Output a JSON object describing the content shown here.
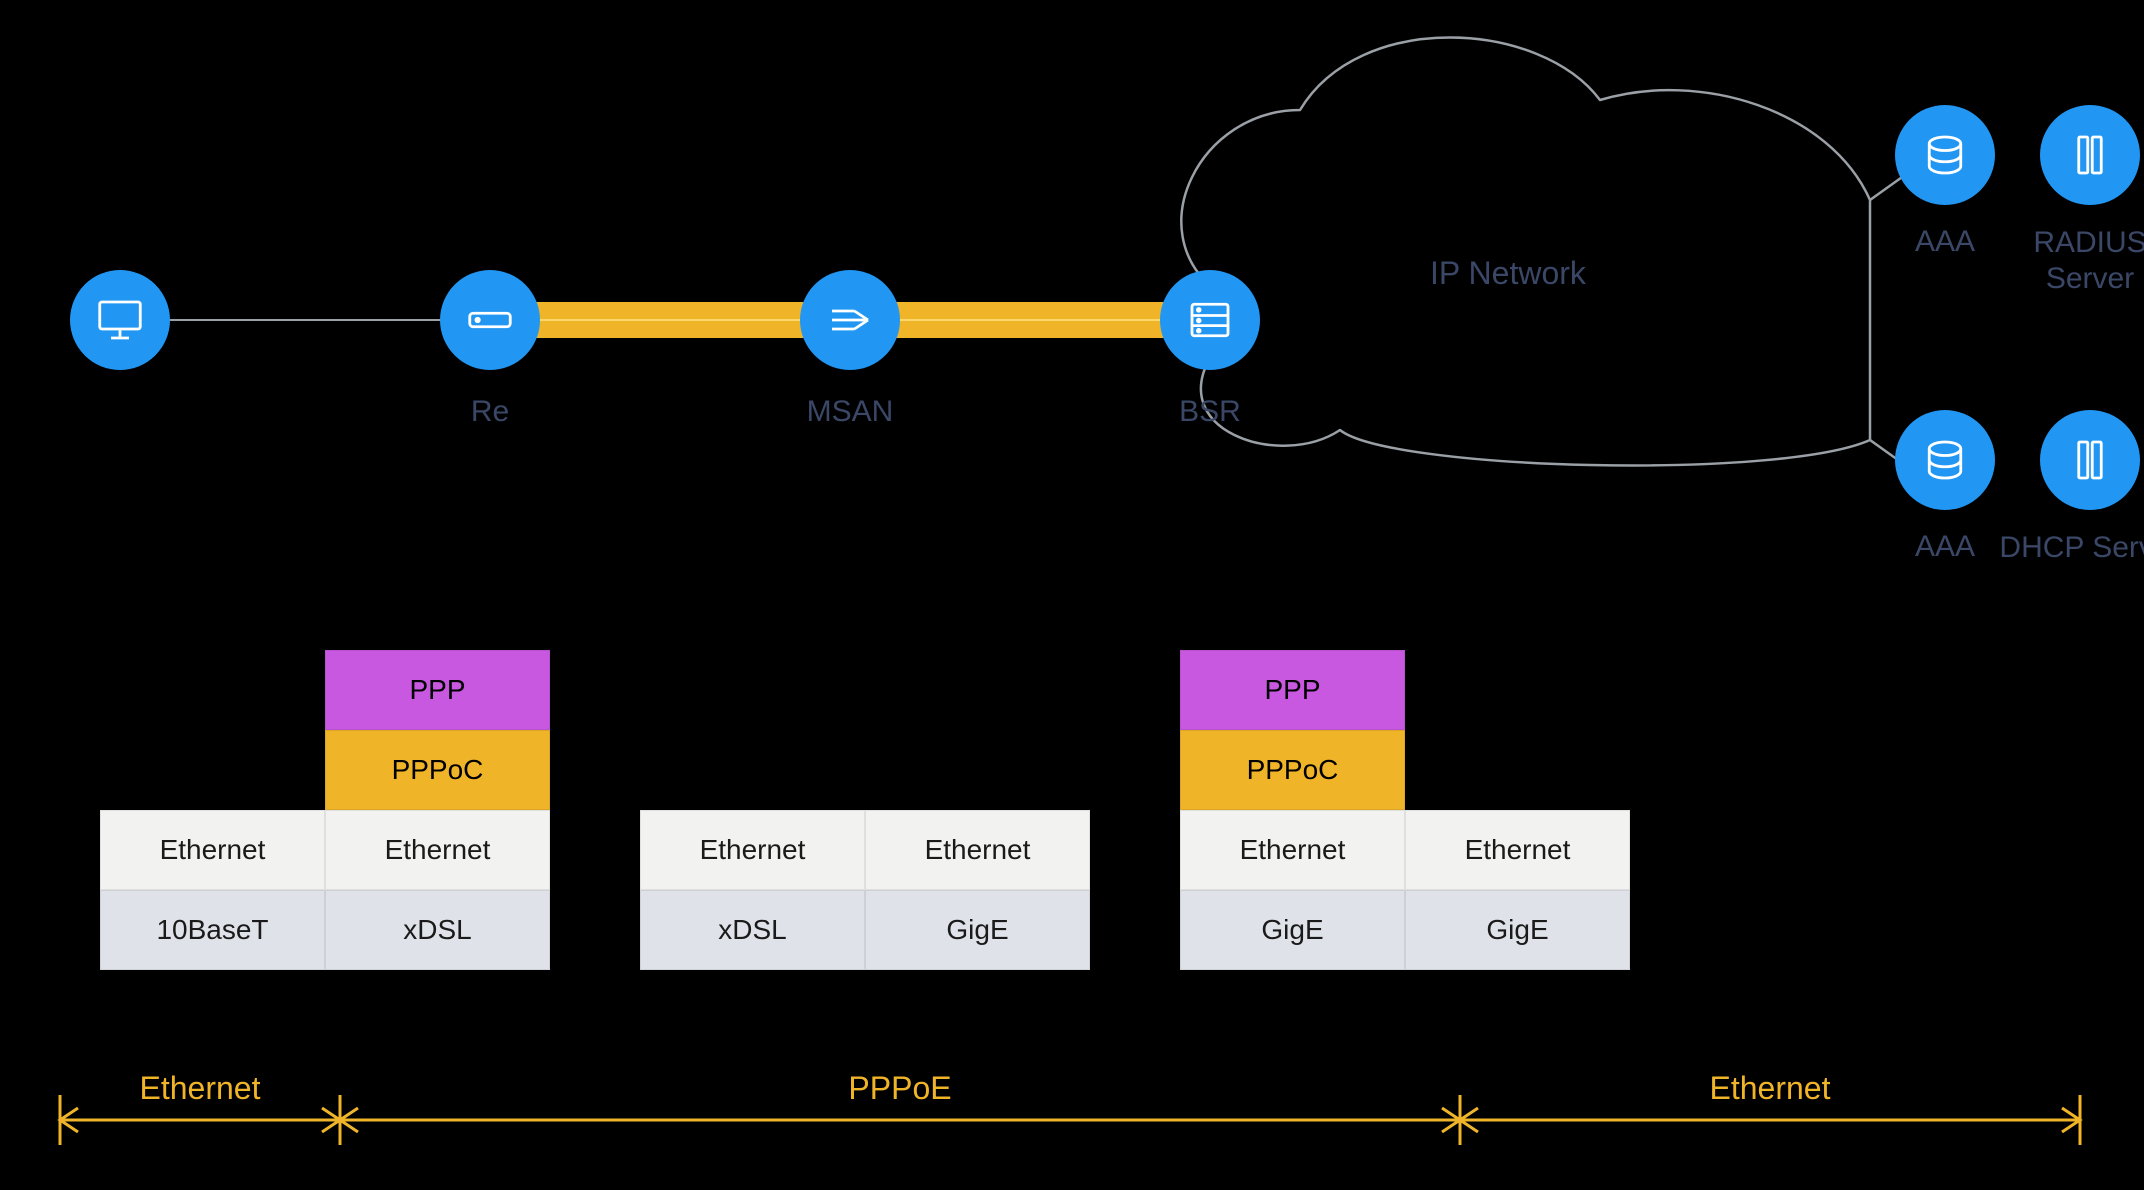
{
  "topology": {
    "nodes": {
      "client": {
        "icon": "monitor-icon"
      },
      "re": {
        "label": "Re",
        "icon": "modem-icon"
      },
      "msan": {
        "label": "MSAN",
        "icon": "switch-icon"
      },
      "bsr": {
        "label": "BSR",
        "icon": "router-icon"
      }
    },
    "cloud_label": "IP Network",
    "servers": {
      "top_left": {
        "label": "AAA",
        "icon": "database-icon"
      },
      "top_right": {
        "label": "RADIUS Server",
        "icon": "rack-icon"
      },
      "bot_left": {
        "label": "AAA",
        "icon": "database-icon"
      },
      "bot_right": {
        "label": "DHCP Server",
        "icon": "rack-icon"
      }
    }
  },
  "stacks": {
    "left": {
      "col1": {
        "ppp": "",
        "pppoc": "",
        "eth": "Ethernet",
        "phy": "10BaseT"
      },
      "col2": {
        "ppp": "PPP",
        "pppoc": "PPPoC",
        "eth": "Ethernet",
        "phy": "xDSL"
      }
    },
    "mid": {
      "col1": {
        "eth": "Ethernet",
        "phy": "xDSL"
      },
      "col2": {
        "eth": "Ethernet",
        "phy": "GigE"
      }
    },
    "right": {
      "col1": {
        "ppp": "PPP",
        "pppoc": "PPPoC",
        "eth": "Ethernet",
        "phy": "GigE"
      },
      "col2": {
        "ppp": "",
        "pppoc": "",
        "eth": "Ethernet",
        "phy": "GigE"
      }
    }
  },
  "ranges": {
    "left": "Ethernet",
    "middle": "PPPoE",
    "right": "Ethernet"
  },
  "colors": {
    "node": "#2196f3",
    "accent": "#f0b429",
    "ppp": "#c858e0",
    "line": "#9aa0a6",
    "text_muted": "#3a4766"
  }
}
